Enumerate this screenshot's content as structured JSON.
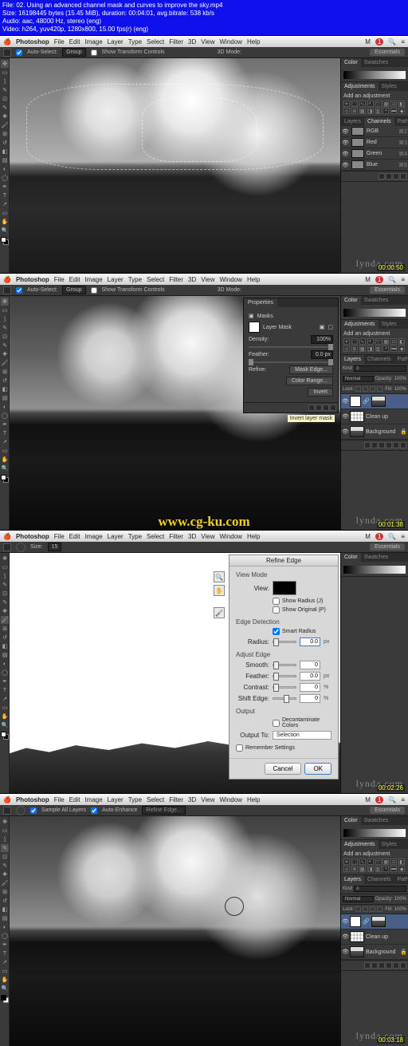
{
  "file_info": {
    "line1": "File: 02. Using an advanced channel mask and curves to improve the sky.mp4",
    "line2": "Size: 16198445 bytes (15.45 MiB), duration: 00:04:01, avg.bitrate: 538 kb/s",
    "line3": "Audio: aac, 48000 Hz, stereo (eng)",
    "line4": "Video: h264, yuv420p, 1280x800, 15.00 fps(r) (eng)"
  },
  "menu": {
    "app": "Photoshop",
    "items": [
      "File",
      "Edit",
      "Image",
      "Layer",
      "Type",
      "Select",
      "Filter",
      "3D",
      "View",
      "Window",
      "Help"
    ]
  },
  "options": {
    "move": {
      "auto_select": "Auto-Select:",
      "group": "Group",
      "transform": "Show Transform Controls",
      "mode": "3D Mode:"
    },
    "brush": {
      "size_label": "Size:",
      "size_val": "15"
    },
    "quick": {
      "sample": "Sample All Layers",
      "enhance": "Auto-Enhance",
      "refine": "Refine Edge..."
    }
  },
  "workspace": "Essentials",
  "panels": {
    "color": {
      "tab1": "Color",
      "tab2": "Swatches"
    },
    "adj": {
      "tab1": "Adjustments",
      "tab2": "Styles",
      "label": "Add an adjustment"
    },
    "layers_tabs": {
      "t1": "Layers",
      "t2": "Channels",
      "t3": "Paths"
    },
    "channels": [
      {
        "name": "RGB",
        "key": "⌘2"
      },
      {
        "name": "Red",
        "key": "⌘3"
      },
      {
        "name": "Green",
        "key": "⌘4"
      },
      {
        "name": "Blue",
        "key": "⌘5"
      }
    ],
    "layers": {
      "kind": "Kind",
      "blend": "Normal",
      "opacity_label": "Opacity:",
      "opacity_val": "100%",
      "lock_label": "Lock:",
      "fill_label": "Fill:",
      "fill_val": "100%",
      "items": [
        {
          "name": ""
        },
        {
          "name": "Clean up"
        },
        {
          "name": "Background"
        }
      ]
    }
  },
  "properties": {
    "tab": "Properties",
    "title": "Masks",
    "type": "Layer Mask",
    "density_label": "Density:",
    "density_val": "100%",
    "feather_label": "Feather:",
    "feather_val": "0.0 px",
    "refine_label": "Refine:",
    "mask_edge": "Mask Edge...",
    "color_range": "Color Range...",
    "invert": "Invert",
    "tooltip": "Invert layer mask"
  },
  "refine": {
    "title": "Refine Edge",
    "view_mode": "View Mode",
    "view": "View:",
    "show_radius": "Show Radius (J)",
    "show_original": "Show Original (P)",
    "edge_detection": "Edge Detection",
    "smart_radius": "Smart Radius",
    "radius": "Radius:",
    "radius_val": "0.0",
    "adjust_edge": "Adjust Edge",
    "smooth": "Smooth:",
    "smooth_val": "0",
    "feather": "Feather:",
    "feather_val": "0.0",
    "contrast": "Contrast:",
    "contrast_val": "0",
    "shift": "Shift Edge:",
    "shift_val": "0",
    "output": "Output",
    "decontaminate": "Decontaminate Colors",
    "output_to": "Output To:",
    "output_sel": "Selection",
    "remember": "Remember Settings",
    "cancel": "Cancel",
    "ok": "OK"
  },
  "overlay": {
    "watermark": "lynda.com",
    "url": "www.cg-ku.com",
    "t1": "00:00:50",
    "t2": "00:01:38",
    "t3": "00:02:26",
    "t4": "00:03:18"
  },
  "right_badge": "1",
  "right_badge_prefix": "M"
}
